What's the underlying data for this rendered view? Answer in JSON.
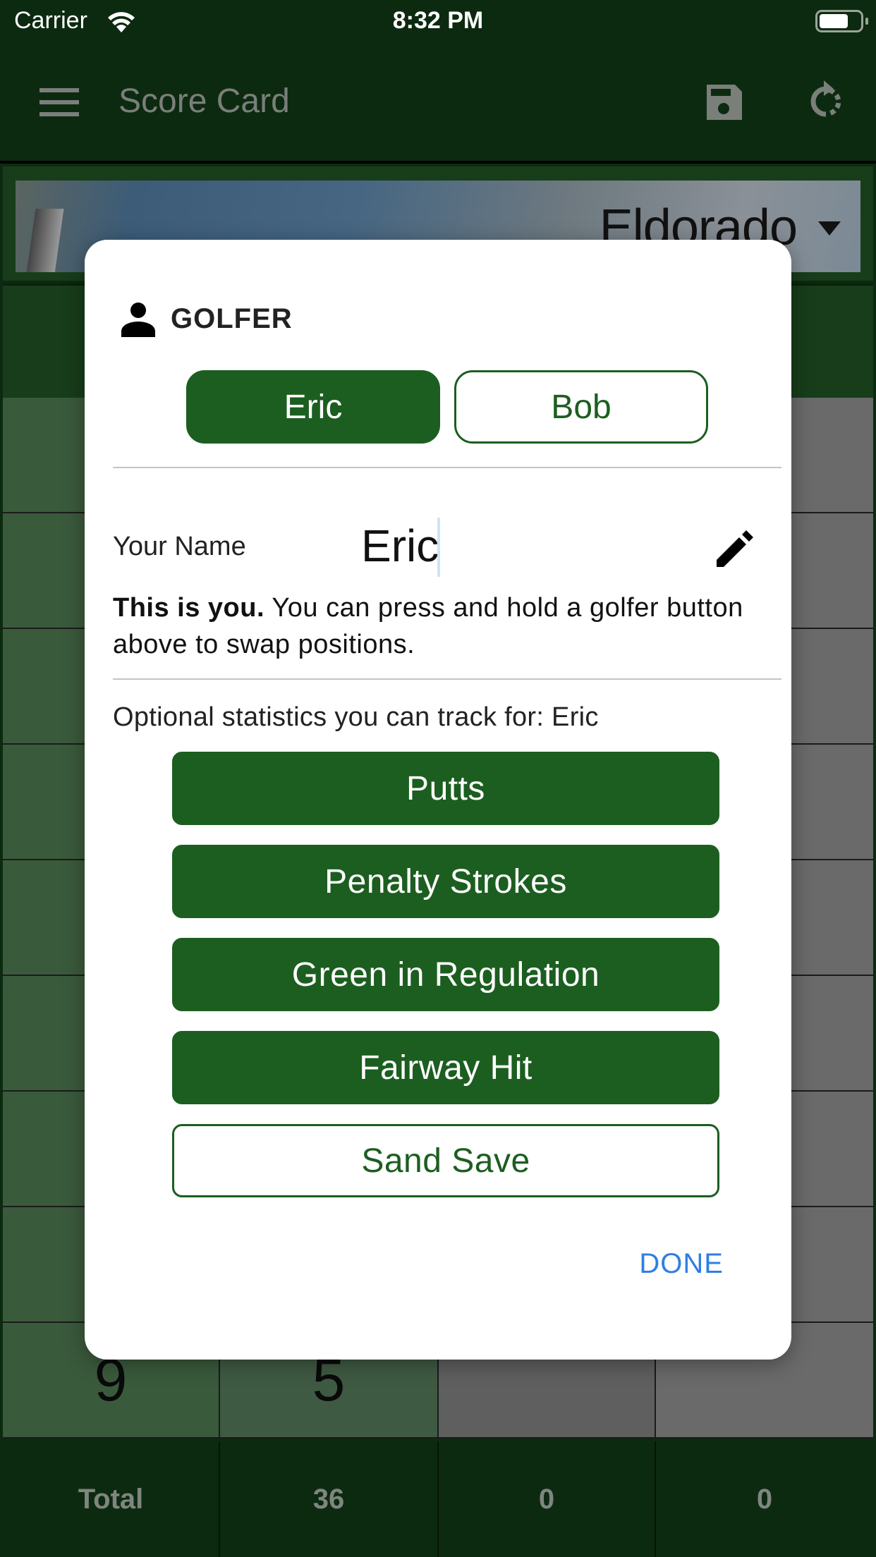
{
  "status_bar": {
    "carrier": "Carrier",
    "time": "8:32 PM",
    "icons": [
      "wifi-icon",
      "battery-icon"
    ]
  },
  "appbar": {
    "title": "Score Card",
    "icons": [
      "menu-icon",
      "save-icon",
      "refresh-icon"
    ]
  },
  "course": {
    "name": "Eldorado"
  },
  "scorecard": {
    "visible_row": {
      "hole": "9",
      "par": "5",
      "p1": "",
      "p2": ""
    },
    "totals": {
      "label": "Total",
      "par": "36",
      "p1": "0",
      "p2": "0"
    }
  },
  "dialog": {
    "header": "GOLFER",
    "golfers": [
      {
        "name": "Eric",
        "selected": true
      },
      {
        "name": "Bob",
        "selected": false
      }
    ],
    "name_label": "Your Name",
    "name_value": "Eric",
    "hint_bold": "This is you.",
    "hint_text": " You can press and hold a golfer button above to swap positions.",
    "stats_caption": "Optional statistics you can track for: Eric",
    "stats": [
      {
        "label": "Putts",
        "enabled": true
      },
      {
        "label": "Penalty Strokes",
        "enabled": true
      },
      {
        "label": "Green in Regulation",
        "enabled": true
      },
      {
        "label": "Fairway Hit",
        "enabled": true
      },
      {
        "label": "Sand Save",
        "enabled": false
      }
    ],
    "done_label": "DONE"
  },
  "colors": {
    "brand_green": "#1c5e20",
    "appbar_bg": "#0c2a10",
    "link_blue": "#2f7fe3"
  }
}
